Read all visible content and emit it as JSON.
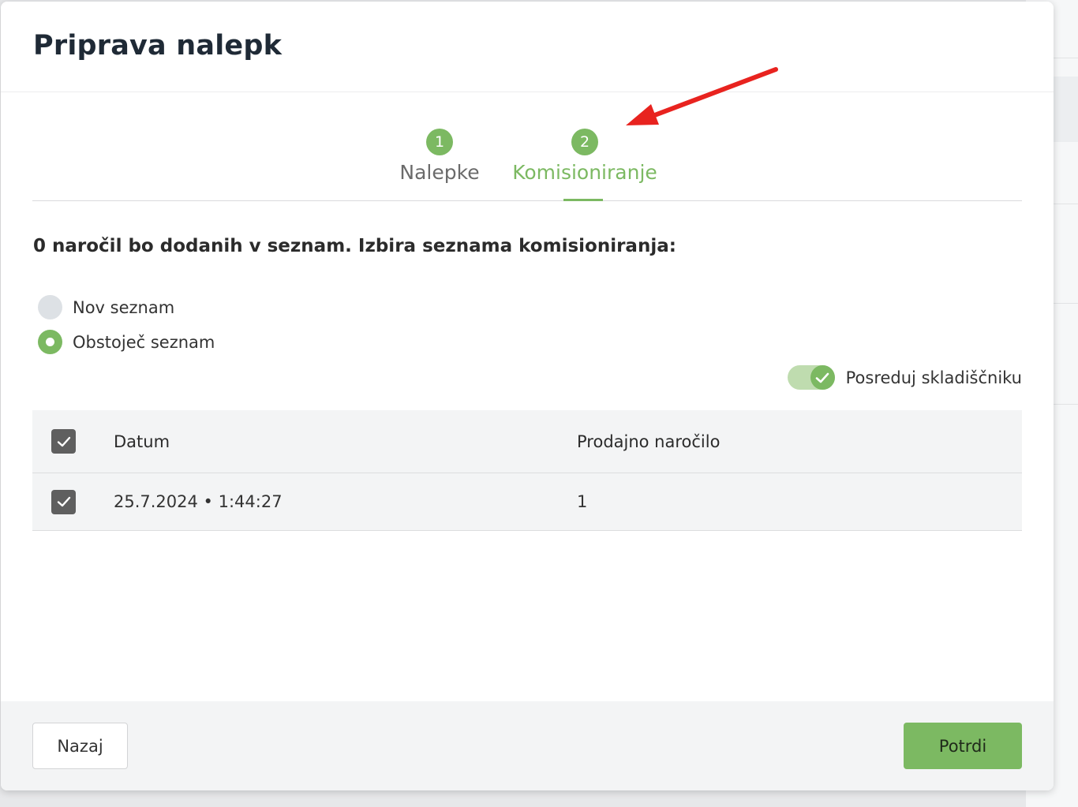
{
  "modal": {
    "title": "Priprava nalepk"
  },
  "steps": [
    {
      "number": "1",
      "label": "Nalepke",
      "active": false
    },
    {
      "number": "2",
      "label": "Komisioniranje",
      "active": true
    }
  ],
  "summary_text": "0 naročil bo dodanih v seznam. Izbira seznama komisioniranja:",
  "list_options": [
    {
      "label": "Nov seznam",
      "selected": false
    },
    {
      "label": "Obstoječ seznam",
      "selected": true
    }
  ],
  "toggle": {
    "label": "Posreduj skladiščniku",
    "on": true
  },
  "table": {
    "columns": [
      "Datum",
      "Prodajno naročilo"
    ],
    "rows": [
      {
        "checked": true,
        "date": "25.7.2024 • 1:44:27",
        "order": "1"
      }
    ],
    "select_all_checked": true
  },
  "footer": {
    "back_label": "Nazaj",
    "confirm_label": "Potrdi"
  },
  "colors": {
    "accent": "#7cb962",
    "annotation_arrow": "#e8231f"
  }
}
